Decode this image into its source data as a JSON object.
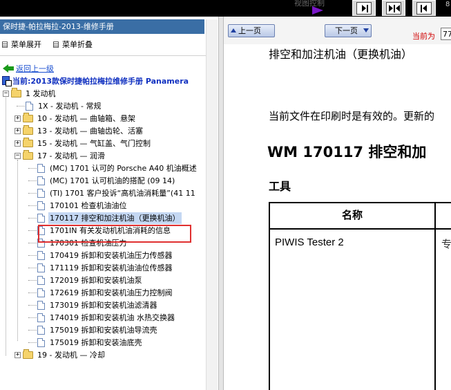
{
  "topbar": {
    "sub_text": "视图控制",
    "edge_text": "8"
  },
  "left_panel": {
    "title": "保时捷-帕拉梅拉-2013-维修手册",
    "menu_expand": "菜单展开",
    "menu_collapse": "菜单折叠",
    "back_link": "返回上一级",
    "current_book": "当前:2013款保时捷帕拉梅拉维修手册 Panamera"
  },
  "tree": [
    {
      "label": "1 发动机",
      "type": "folder",
      "expanded": true
    },
    {
      "label": "1X - 发动机 - 常规",
      "type": "doc"
    },
    {
      "label": "10 - 发动机 — 曲轴箱、悬架",
      "type": "folder",
      "expanded": false
    },
    {
      "label": "13 - 发动机 — 曲轴齿轮、活塞",
      "type": "folder",
      "expanded": false
    },
    {
      "label": "15 - 发动机 — 气缸盖、气门控制",
      "type": "folder",
      "expanded": false
    },
    {
      "label": "17 - 发动机 — 润滑",
      "type": "folder",
      "expanded": true
    },
    {
      "label": "(MC) 1701 认可的 Porsche A40 机油概述",
      "type": "doc"
    },
    {
      "label": "(MC) 1701 认可机油的搭配 (09 14)",
      "type": "doc"
    },
    {
      "label": "(TI) 1701 客户投诉“高机油消耗量”(41 11",
      "type": "doc"
    },
    {
      "label": "170101 检查机油油位",
      "type": "doc"
    },
    {
      "label": "170117 排空和加注机油（更换机油）",
      "type": "doc",
      "selected": true
    },
    {
      "label": "1701IN 有关发动机机油消耗的信息",
      "type": "doc"
    },
    {
      "label": "170301 检查机油压力",
      "type": "doc"
    },
    {
      "label": "170419 拆卸和安装机油压力传感器",
      "type": "doc"
    },
    {
      "label": "171119 拆卸和安装机油油位传感器",
      "type": "doc"
    },
    {
      "label": "172019 拆卸和安装机油泵",
      "type": "doc"
    },
    {
      "label": "172619 拆卸和安装机油压力控制阀",
      "type": "doc"
    },
    {
      "label": "173019 拆卸和安装机油滤清器",
      "type": "doc"
    },
    {
      "label": "174019 拆卸和安装机油 水热交换器",
      "type": "doc"
    },
    {
      "label": "175019 拆卸和安装机油导流壳",
      "type": "doc"
    },
    {
      "label": "175019 拆卸和安装油底壳",
      "type": "doc"
    },
    {
      "label": "19 - 发动机 — 冷却",
      "type": "folder",
      "expanded": false
    }
  ],
  "right_panel": {
    "prev_page": "上一页",
    "next_page": "下一页",
    "current_page_label": "当前为",
    "current_page_value": "77",
    "doc_top_title": "排空和加注机油（更换机油）",
    "validity": "当前文件在印刷时是有效的。更新的",
    "section_title": "WM 170117 排空和加",
    "tools_heading": "工具",
    "table_header_name": "名称",
    "table_row1_name": "PIWIS Tester 2",
    "table_row1_col2": "专"
  },
  "colors": {
    "title_bar": "#3a6ea5",
    "selection": "#c4d7f2",
    "highlight_box": "#e03030",
    "link": "#1a4fd0",
    "page_label": "#d00000"
  }
}
